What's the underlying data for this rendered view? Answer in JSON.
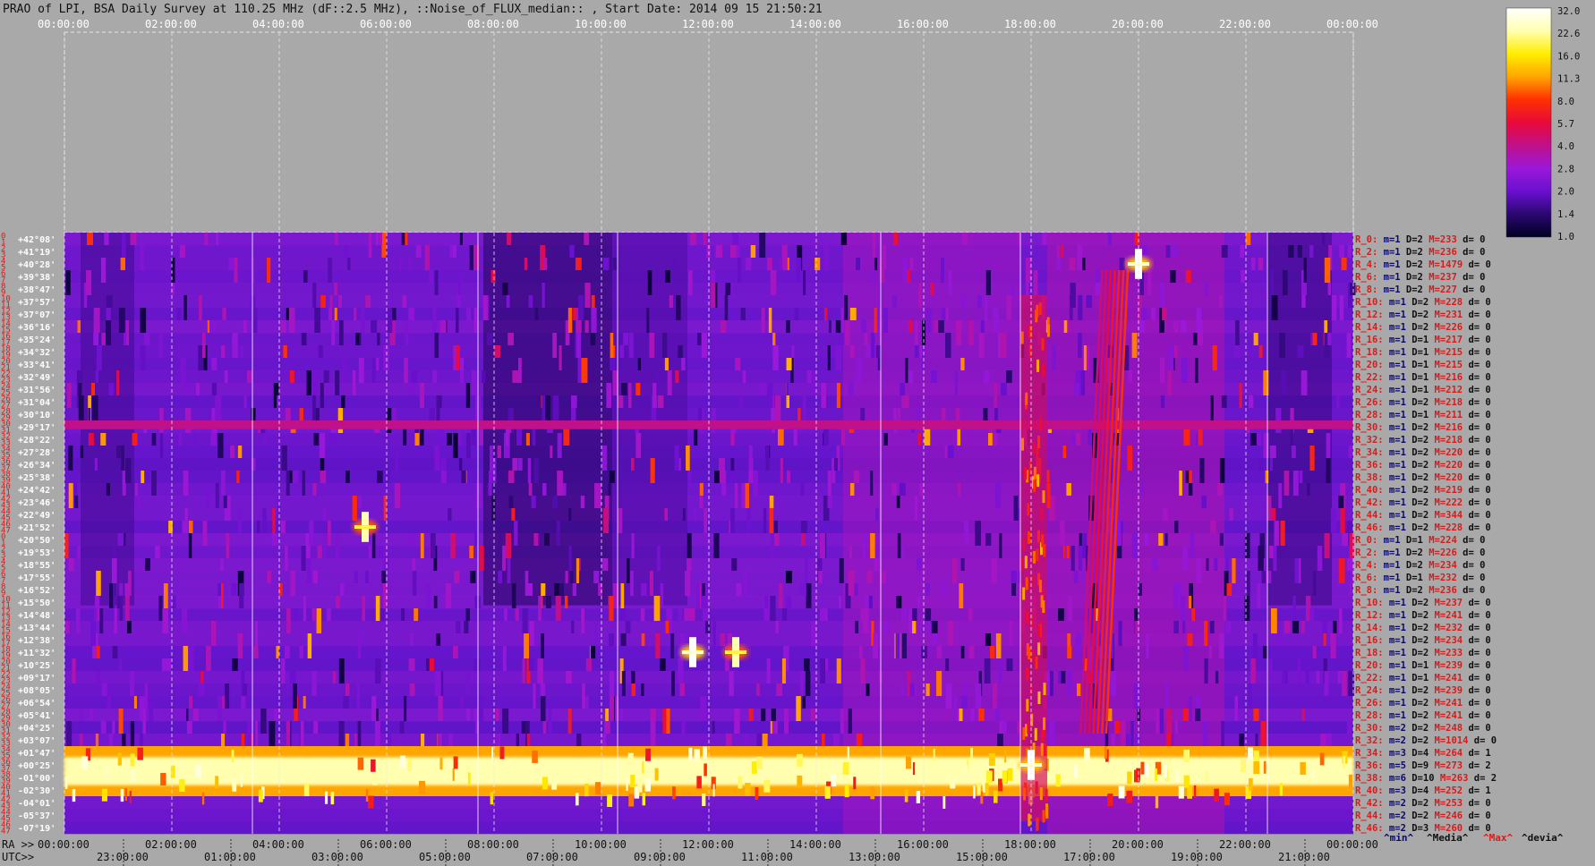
{
  "title": "PRAO of LPI, BSA Daily Survey at 110.25 MHz (dF::2.5 MHz), ::Noise_of_FLUX_median:: , Start Date: 2014 09 15 21:50:21",
  "axes": {
    "top_ticks": [
      "00:00:00",
      "02:00:00",
      "04:00:00",
      "06:00:00",
      "08:00:00",
      "10:00:00",
      "12:00:00",
      "14:00:00",
      "16:00:00",
      "18:00:00",
      "20:00:00",
      "22:00:00",
      "00:00:00"
    ],
    "ra_label": "RA >>",
    "bottom_ra_ticks": [
      "00:00:00",
      "02:00:00",
      "04:00:00",
      "06:00:00",
      "08:00:00",
      "10:00:00",
      "12:00:00",
      "14:00:00",
      "16:00:00",
      "18:00:00",
      "20:00:00",
      "22:00:00",
      "00:00:00"
    ],
    "utc_label": "UTC>>",
    "utc_ticks": [
      "23:00:00",
      "01:00:00",
      "03:00:00",
      "05:00:00",
      "07:00:00",
      "09:00:00",
      "11:00:00",
      "13:00:00",
      "15:00:00",
      "17:00:00",
      "19:00:00",
      "21:00:00"
    ]
  },
  "declinations": [
    "+42°08'",
    "+41°19'",
    "+40°28'",
    "+39°38'",
    "+38°47'",
    "+37°57'",
    "+37°07'",
    "+36°16'",
    "+35°24'",
    "+34°32'",
    "+33°41'",
    "+32°49'",
    "+31°56'",
    "+31°04'",
    "+30°10'",
    "+29°17'",
    "+28°22'",
    "+27°28'",
    "+26°34'",
    "+25°38'",
    "+24°42'",
    "+23°46'",
    "+22°49'",
    "+21°52'",
    "+20°50'",
    "+19°53'",
    "+18°55'",
    "+17°55'",
    "+16°52'",
    "+15°50'",
    "+14°48'",
    "+13°44'",
    "+12°38'",
    "+11°32'",
    "+10°25'",
    "+09°17'",
    "+08°05'",
    "+06°54'",
    "+05°41'",
    "+04°25'",
    "+03°07'",
    "+01°47'",
    "+00°25'",
    "-01°00'",
    "-02°30'",
    "-04°01'",
    "-05°37'",
    "-07°19'"
  ],
  "row_indices": [
    "0",
    "1",
    "2",
    "3",
    "4",
    "5",
    "6",
    "7",
    "8",
    "9",
    "10",
    "11",
    "12",
    "13",
    "14",
    "15",
    "16",
    "17",
    "18",
    "19",
    "20",
    "21",
    "22",
    "23",
    "24",
    "25",
    "26",
    "27",
    "28",
    "29",
    "30",
    "31",
    "32",
    "33",
    "34",
    "35",
    "36",
    "37",
    "38",
    "39",
    "40",
    "41",
    "42",
    "43",
    "44",
    "45",
    "46",
    "47",
    "0",
    "1",
    "2",
    "3",
    "4",
    "5",
    "6",
    "7",
    "8",
    "9",
    "10",
    "11",
    "12",
    "13",
    "14",
    "15",
    "16",
    "17",
    "18",
    "19",
    "20",
    "21",
    "22",
    "23",
    "24",
    "25",
    "26",
    "27",
    "28",
    "29",
    "30",
    "31",
    "32",
    "33",
    "34",
    "35",
    "36",
    "37",
    "38",
    "39",
    "40",
    "41",
    "42",
    "43",
    "44",
    "45",
    "46",
    "47"
  ],
  "stats": [
    {
      "r": "R_0:",
      "m": "m=1",
      "D": "D=2",
      "M": "M=233",
      "d": "d= 0"
    },
    {
      "r": "R_2:",
      "m": "m=1",
      "D": "D=2",
      "M": "M=236",
      "d": "d= 0"
    },
    {
      "r": "R_4:",
      "m": "m=1",
      "D": "D=2",
      "M": "M=1479",
      "d": "d= 0"
    },
    {
      "r": "R_6:",
      "m": "m=1",
      "D": "D=2",
      "M": "M=237",
      "d": "d= 0"
    },
    {
      "r": "R_8:",
      "m": "m=1",
      "D": "D=2",
      "M": "M=227",
      "d": "d= 0"
    },
    {
      "r": "R_10:",
      "m": "m=1",
      "D": "D=2",
      "M": "M=228",
      "d": "d= 0"
    },
    {
      "r": "R_12:",
      "m": "m=1",
      "D": "D=2",
      "M": "M=231",
      "d": "d= 0"
    },
    {
      "r": "R_14:",
      "m": "m=1",
      "D": "D=2",
      "M": "M=226",
      "d": "d= 0"
    },
    {
      "r": "R_16:",
      "m": "m=1",
      "D": "D=1",
      "M": "M=217",
      "d": "d= 0"
    },
    {
      "r": "R_18:",
      "m": "m=1",
      "D": "D=1",
      "M": "M=215",
      "d": "d= 0"
    },
    {
      "r": "R_20:",
      "m": "m=1",
      "D": "D=1",
      "M": "M=215",
      "d": "d= 0"
    },
    {
      "r": "R_22:",
      "m": "m=1",
      "D": "D=1",
      "M": "M=216",
      "d": "d= 0"
    },
    {
      "r": "R_24:",
      "m": "m=1",
      "D": "D=1",
      "M": "M=212",
      "d": "d= 0"
    },
    {
      "r": "R_26:",
      "m": "m=1",
      "D": "D=2",
      "M": "M=218",
      "d": "d= 0"
    },
    {
      "r": "R_28:",
      "m": "m=1",
      "D": "D=1",
      "M": "M=211",
      "d": "d= 0"
    },
    {
      "r": "R_30:",
      "m": "m=1",
      "D": "D=2",
      "M": "M=216",
      "d": "d= 0"
    },
    {
      "r": "R_32:",
      "m": "m=1",
      "D": "D=2",
      "M": "M=218",
      "d": "d= 0"
    },
    {
      "r": "R_34:",
      "m": "m=1",
      "D": "D=2",
      "M": "M=220",
      "d": "d= 0"
    },
    {
      "r": "R_36:",
      "m": "m=1",
      "D": "D=2",
      "M": "M=220",
      "d": "d= 0"
    },
    {
      "r": "R_38:",
      "m": "m=1",
      "D": "D=2",
      "M": "M=220",
      "d": "d= 0"
    },
    {
      "r": "R_40:",
      "m": "m=1",
      "D": "D=2",
      "M": "M=219",
      "d": "d= 0"
    },
    {
      "r": "R_42:",
      "m": "m=1",
      "D": "D=2",
      "M": "M=222",
      "d": "d= 0"
    },
    {
      "r": "R_44:",
      "m": "m=1",
      "D": "D=2",
      "M": "M=344",
      "d": "d= 0"
    },
    {
      "r": "R_46:",
      "m": "m=1",
      "D": "D=2",
      "M": "M=228",
      "d": "d= 0"
    },
    {
      "r": "R_0:",
      "m": "m=1",
      "D": "D=1",
      "M": "M=224",
      "d": "d= 0"
    },
    {
      "r": "R_2:",
      "m": "m=1",
      "D": "D=2",
      "M": "M=226",
      "d": "d= 0"
    },
    {
      "r": "R_4:",
      "m": "m=1",
      "D": "D=2",
      "M": "M=234",
      "d": "d= 0"
    },
    {
      "r": "R_6:",
      "m": "m=1",
      "D": "D=1",
      "M": "M=232",
      "d": "d= 0"
    },
    {
      "r": "R_8:",
      "m": "m=1",
      "D": "D=2",
      "M": "M=236",
      "d": "d= 0"
    },
    {
      "r": "R_10:",
      "m": "m=1",
      "D": "D=2",
      "M": "M=237",
      "d": "d= 0"
    },
    {
      "r": "R_12:",
      "m": "m=1",
      "D": "D=2",
      "M": "M=241",
      "d": "d= 0"
    },
    {
      "r": "R_14:",
      "m": "m=1",
      "D": "D=2",
      "M": "M=232",
      "d": "d= 0"
    },
    {
      "r": "R_16:",
      "m": "m=1",
      "D": "D=2",
      "M": "M=234",
      "d": "d= 0"
    },
    {
      "r": "R_18:",
      "m": "m=1",
      "D": "D=2",
      "M": "M=233",
      "d": "d= 0"
    },
    {
      "r": "R_20:",
      "m": "m=1",
      "D": "D=1",
      "M": "M=239",
      "d": "d= 0"
    },
    {
      "r": "R_22:",
      "m": "m=1",
      "D": "D=1",
      "M": "M=241",
      "d": "d= 0"
    },
    {
      "r": "R_24:",
      "m": "m=1",
      "D": "D=2",
      "M": "M=239",
      "d": "d= 0"
    },
    {
      "r": "R_26:",
      "m": "m=1",
      "D": "D=2",
      "M": "M=241",
      "d": "d= 0"
    },
    {
      "r": "R_28:",
      "m": "m=1",
      "D": "D=2",
      "M": "M=241",
      "d": "d= 0"
    },
    {
      "r": "R_30:",
      "m": "m=2",
      "D": "D=2",
      "M": "M=248",
      "d": "d= 0"
    },
    {
      "r": "R_32:",
      "m": "m=2",
      "D": "D=2",
      "M": "M=1014",
      "d": "d= 0"
    },
    {
      "r": "R_34:",
      "m": "m=3",
      "D": "D=4",
      "M": "M=264",
      "d": "d= 1"
    },
    {
      "r": "R_36:",
      "m": "m=5",
      "D": "D=9",
      "M": "M=273",
      "d": "d= 2"
    },
    {
      "r": "R_38:",
      "m": "m=6",
      "D": "D=10",
      "M": "M=263",
      "d": "d= 2"
    },
    {
      "r": "R_40:",
      "m": "m=3",
      "D": "D=4",
      "M": "M=252",
      "d": "d= 1"
    },
    {
      "r": "R_42:",
      "m": "m=2",
      "D": "D=2",
      "M": "M=253",
      "d": "d= 0"
    },
    {
      "r": "R_44:",
      "m": "m=2",
      "D": "D=2",
      "M": "M=246",
      "d": "d= 0"
    },
    {
      "r": "R_46:",
      "m": "m=2",
      "D": "D=3",
      "M": "M=260",
      "d": "d= 0"
    }
  ],
  "legend_labels": {
    "min": "^min^",
    "median": "^Media^",
    "max": "^Max^",
    "devia": "^devia^"
  },
  "colorbar": {
    "ticks": [
      "32.0",
      "22.6",
      "16.0",
      "11.3",
      "8.0",
      "5.7",
      "4.0",
      "2.8",
      "2.0",
      "1.4",
      "1.0"
    ],
    "stops": [
      "#ffffff",
      "#ffffb0",
      "#ffee00",
      "#ffa500",
      "#ff3000",
      "#e80a3a",
      "#c0108a",
      "#9a18d8",
      "#6a10d0",
      "#2a0870",
      "#000022"
    ]
  },
  "colors": {
    "background": "#a9a9a9",
    "heatmap_base": "#5a1cc4",
    "stat_r": "#d61c1c",
    "stat_m": "#0a0a6e",
    "stat_D": "#111111",
    "stat_M": "#d61c1c",
    "stat_d": "#111111"
  },
  "chart_data": {
    "type": "heatmap",
    "title": "PRAO of LPI, BSA Daily Survey at 110.25 MHz (dF::2.5 MHz), ::Noise_of_FLUX_median:: , Start Date: 2014 09 15 21:50:21",
    "xlabel": "RA",
    "x_range_hours": [
      0,
      24
    ],
    "rows": 48,
    "color_scale_range": [
      1.0,
      32.0
    ],
    "features": [
      {
        "kind": "band",
        "rows": [
          41,
          44
        ],
        "ra_hours": [
          0,
          24
        ],
        "level": 22.6
      },
      {
        "kind": "band",
        "row": 15,
        "ra_hours": [
          0,
          24
        ],
        "level": 4.0
      },
      {
        "kind": "band",
        "ra_hours": [
          17.8,
          18.3
        ],
        "rows": [
          5,
          47
        ],
        "level": 8.0
      },
      {
        "kind": "stripe",
        "ra_hours": [
          19.0,
          19.8
        ],
        "rows": [
          3,
          40
        ],
        "level": 8.0
      },
      {
        "kind": "source",
        "ra_hours": 20.0,
        "row": 2,
        "level": 32.0
      },
      {
        "kind": "source",
        "ra_hours": 11.7,
        "row": 33,
        "level": 32.0
      },
      {
        "kind": "source",
        "ra_hours": 12.5,
        "row": 33,
        "level": 22.6
      },
      {
        "kind": "source",
        "ra_hours": 5.6,
        "row": 23,
        "level": 22.6
      },
      {
        "kind": "source",
        "ra_hours": 18.0,
        "row": 42,
        "level": 32.0
      }
    ]
  }
}
